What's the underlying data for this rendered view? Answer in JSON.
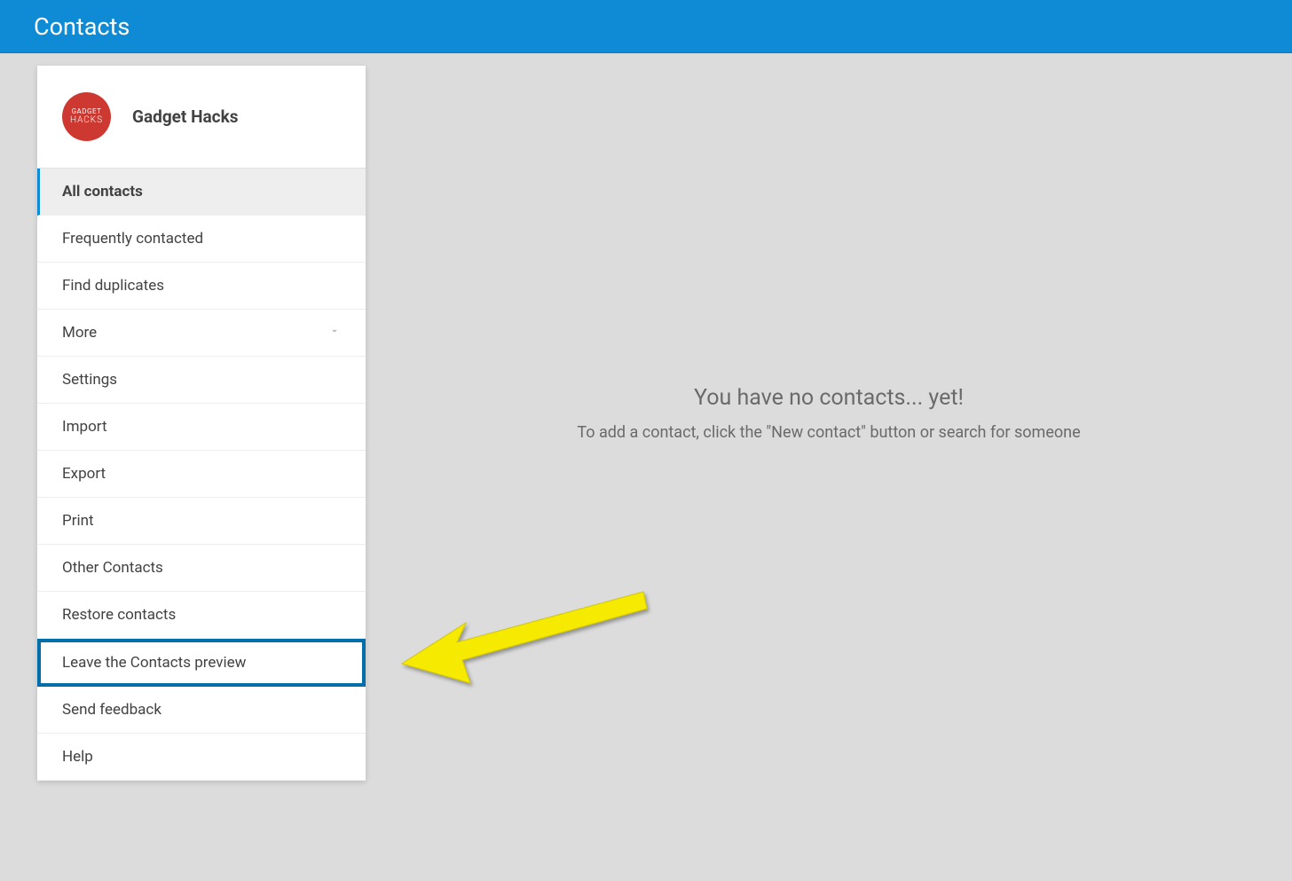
{
  "header": {
    "title": "Contacts"
  },
  "profile": {
    "name": "Gadget Hacks",
    "avatar_text_top": "GADGET",
    "avatar_text_bottom": "HACKS"
  },
  "sidebar": {
    "items": [
      {
        "label": "All contacts",
        "active": true
      },
      {
        "label": "Frequently contacted"
      },
      {
        "label": "Find duplicates"
      },
      {
        "label": "More",
        "has_chevron": true
      },
      {
        "label": "Settings"
      },
      {
        "label": "Import"
      },
      {
        "label": "Export"
      },
      {
        "label": "Print"
      },
      {
        "label": "Other Contacts"
      },
      {
        "label": "Restore contacts"
      },
      {
        "label": "Leave the Contacts preview",
        "highlighted": true
      },
      {
        "label": "Send feedback"
      },
      {
        "label": "Help"
      }
    ]
  },
  "main": {
    "empty_title": "You have no contacts... yet!",
    "empty_subtitle": "To add a contact, click the \"New contact\" button or search for someone"
  }
}
